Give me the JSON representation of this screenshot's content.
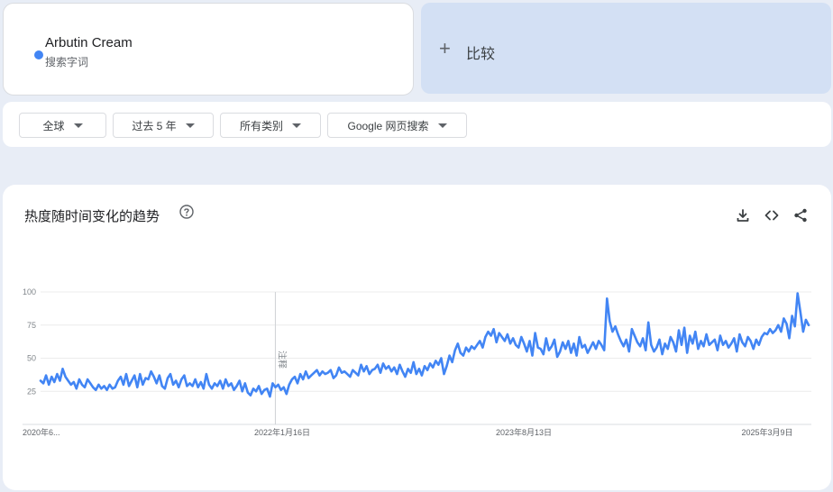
{
  "term": {
    "name": "Arbutin Cream",
    "type": "搜索字词",
    "color": "#4285f4"
  },
  "compare": {
    "label": "比较"
  },
  "filters": [
    {
      "label": "全球"
    },
    {
      "label": "过去 5 年"
    },
    {
      "label": "所有类别"
    },
    {
      "label": "Google 网页搜索"
    }
  ],
  "chart_section": {
    "title": "热度随时间变化的趋势",
    "icons": [
      "help-icon",
      "download-icon",
      "embed-icon",
      "share-icon"
    ],
    "note_label": "注释"
  },
  "chart_data": {
    "type": "line",
    "ylim": [
      0,
      100
    ],
    "yticks": [
      25,
      50,
      75,
      100
    ],
    "x_labels": [
      "2020年6...",
      "2022年1月16日",
      "2023年8月13日",
      "2025年3月9日"
    ],
    "series": [
      {
        "color": "#4285f4",
        "values": [
          33,
          31,
          37,
          30,
          36,
          32,
          38,
          33,
          42,
          36,
          33,
          30,
          32,
          27,
          34,
          30,
          28,
          34,
          31,
          28,
          26,
          30,
          27,
          29,
          26,
          30,
          27,
          28,
          33,
          36,
          30,
          38,
          29,
          33,
          37,
          28,
          38,
          30,
          35,
          34,
          40,
          36,
          31,
          37,
          29,
          27,
          35,
          38,
          30,
          33,
          28,
          34,
          37,
          29,
          31,
          29,
          34,
          28,
          32,
          27,
          38,
          30,
          27,
          31,
          29,
          33,
          27,
          34,
          29,
          31,
          26,
          29,
          33,
          25,
          31,
          24,
          22,
          27,
          25,
          29,
          23,
          26,
          27,
          21,
          31,
          28,
          30,
          26,
          28,
          23,
          30,
          34,
          36,
          31,
          38,
          34,
          40,
          35,
          37,
          39,
          41,
          37,
          40,
          38,
          39,
          41,
          35,
          37,
          43,
          39,
          40,
          38,
          36,
          41,
          39,
          37,
          45,
          40,
          44,
          38,
          41,
          42,
          45,
          39,
          46,
          42,
          44,
          40,
          43,
          38,
          45,
          40,
          36,
          42,
          39,
          47,
          38,
          42,
          37,
          44,
          41,
          46,
          43,
          48,
          45,
          50,
          38,
          44,
          52,
          47,
          56,
          61,
          54,
          52,
          58,
          55,
          59,
          57,
          60,
          63,
          58,
          66,
          70,
          67,
          72,
          62,
          69,
          66,
          63,
          68,
          61,
          65,
          60,
          58,
          66,
          61,
          55,
          63,
          52,
          69,
          58,
          57,
          53,
          65,
          56,
          59,
          64,
          51,
          55,
          62,
          57,
          63,
          54,
          61,
          52,
          66,
          58,
          60,
          54,
          58,
          62,
          57,
          63,
          60,
          56,
          95,
          78,
          70,
          74,
          68,
          63,
          59,
          64,
          55,
          72,
          67,
          62,
          59,
          65,
          56,
          77,
          60,
          55,
          58,
          64,
          53,
          61,
          57,
          66,
          62,
          55,
          71,
          60,
          73,
          54,
          67,
          61,
          70,
          57,
          63,
          59,
          68,
          60,
          62,
          64,
          56,
          67,
          60,
          63,
          58,
          61,
          65,
          55,
          68,
          62,
          59,
          66,
          63,
          57,
          64,
          60,
          66,
          69,
          68,
          72,
          69,
          71,
          75,
          70,
          80,
          76,
          65,
          82,
          74,
          99,
          85,
          70,
          79,
          75
        ]
      }
    ],
    "annotation": {
      "label": "注释",
      "x_index": 84
    }
  }
}
